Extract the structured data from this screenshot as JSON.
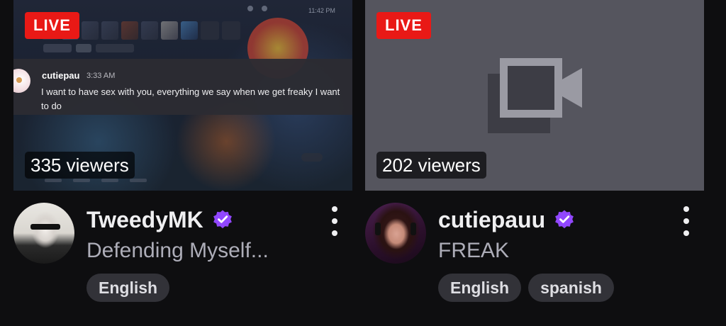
{
  "colors": {
    "background": "#0e0e10",
    "live_badge": "#e91916",
    "verified": "#9147ff",
    "tag_bg": "#323238",
    "placeholder_bg": "#55555e"
  },
  "cards": [
    {
      "live_label": "LIVE",
      "viewers": "335 viewers",
      "channel_name": "TweedyMK",
      "verified_icon": "verified-badge-icon",
      "stream_title": "Defending Myself...",
      "tags": [
        "English"
      ],
      "thumbnail": {
        "time": "11:42 PM",
        "notification": {
          "username": "cutiepau",
          "time": "3:33 AM",
          "message": "I want to have sex with you, everything we say when we get freaky I want to do"
        }
      }
    },
    {
      "live_label": "LIVE",
      "viewers": "202 viewers",
      "channel_name": "cutiepauu",
      "verified_icon": "verified-badge-icon",
      "stream_title": "FREAK",
      "tags": [
        "English",
        "spanish"
      ],
      "thumbnail": {
        "icon": "video-camera-icon"
      }
    }
  ]
}
